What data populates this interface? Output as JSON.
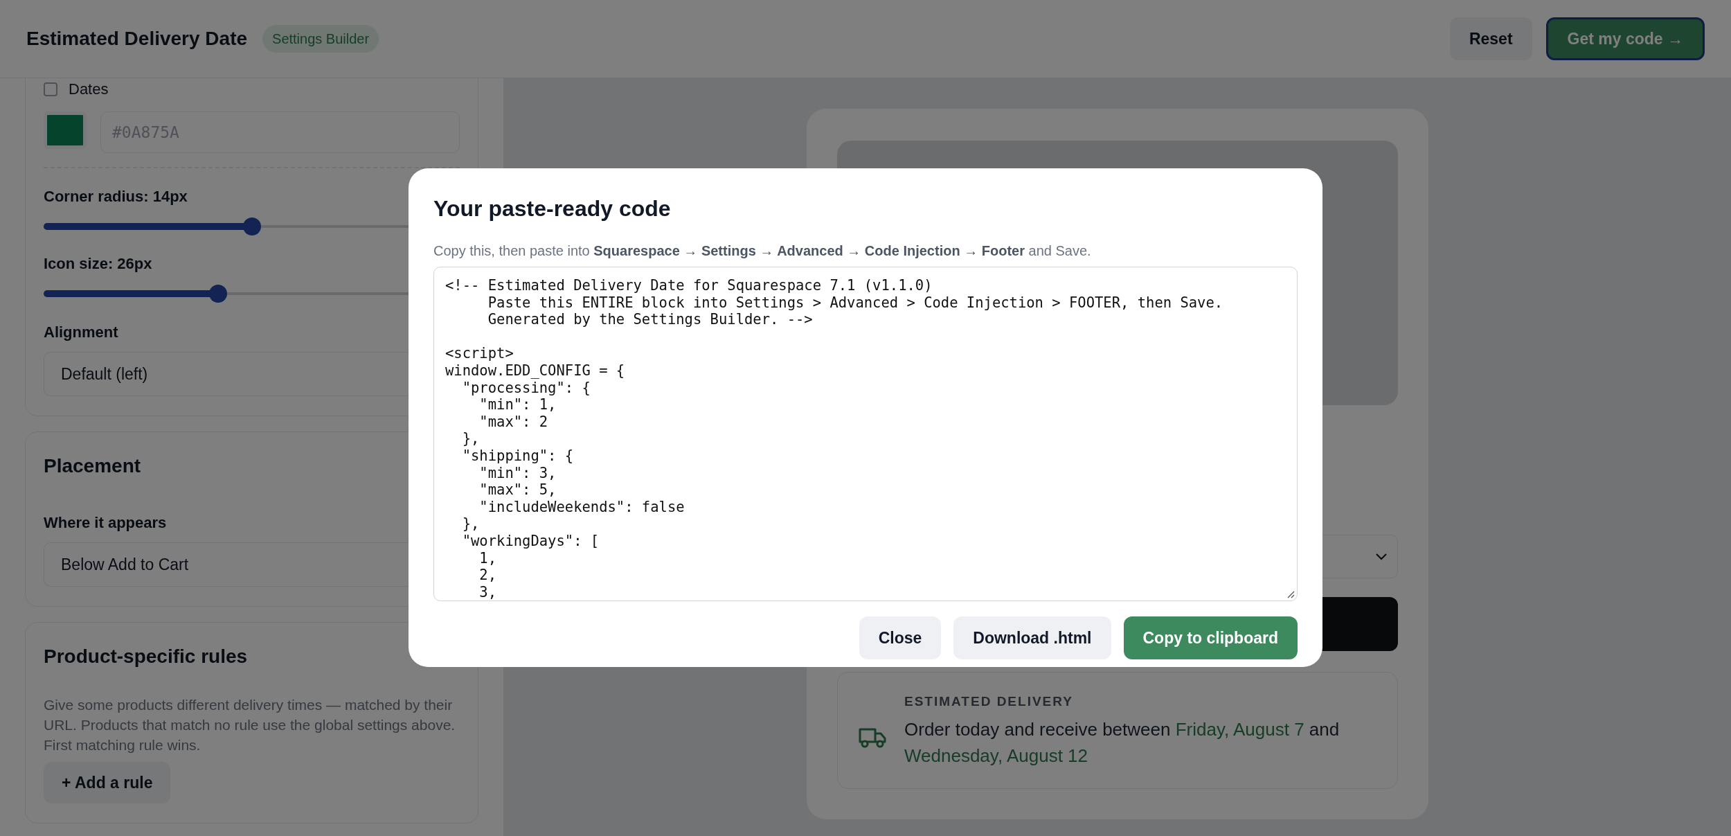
{
  "header": {
    "title": "Estimated Delivery Date",
    "badge": "Settings Builder",
    "buttons": [
      {
        "label": "Reset",
        "kind": "secondary"
      },
      {
        "label": "Get my code →",
        "kind": "primary"
      }
    ]
  },
  "style_card": {
    "checkbox": {
      "label": "Dates",
      "checked": false
    },
    "color_value": "#0A875A",
    "sliders": [
      {
        "label": "Corner radius: 14px",
        "level": 0.5
      },
      {
        "label": "Icon size: 26px",
        "level": 0.42
      }
    ],
    "alignment": {
      "label": "Alignment",
      "value": "Default (left)"
    }
  },
  "placement": {
    "title": "Placement",
    "field_label": "Where it appears",
    "value": "Below Add to Cart"
  },
  "rules": {
    "title": "Product-specific rules",
    "description": "Give some products different delivery times — matched by their URL. Products that match no rule use the global settings above. First matching rule wins.",
    "button": "+ Add a rule"
  },
  "preview": {
    "delivery_label": "ESTIMATED DELIVERY",
    "delivery_text": "Order today and receive between **Friday, August 7** and **Wednesday, August 12**"
  },
  "modal": {
    "title": "Your paste-ready code",
    "description": "Copy this, then paste into **Squarespace → Settings → Advanced → Code Injection → Footer** and Save.",
    "code_blocks": [
      [
        "<!-- Estimated Delivery Date for Squarespace 7.1 (v1.1.0)",
        "     Paste this ENTIRE block into Settings > Advanced > Code Injection > FOOTER, then Save.",
        "     Generated by the Settings Builder. -->"
      ],
      [
        "<script>",
        "window.EDD_CONFIG = {",
        "  \"processing\": {",
        "    \"min\": 1,",
        "    \"max\": 2",
        "  },",
        "  \"shipping\": {",
        "    \"min\": 3,",
        "    \"max\": 5,",
        "    \"includeWeekends\": false",
        "  },",
        "  \"workingDays\": [",
        "    1,",
        "    2,",
        "    3,"
      ]
    ],
    "buttons": [
      {
        "label": "Close",
        "kind": "secondary"
      },
      {
        "label": "Download .html",
        "kind": "secondary"
      },
      {
        "label": "Copy to clipboard",
        "kind": "primary"
      }
    ]
  }
}
